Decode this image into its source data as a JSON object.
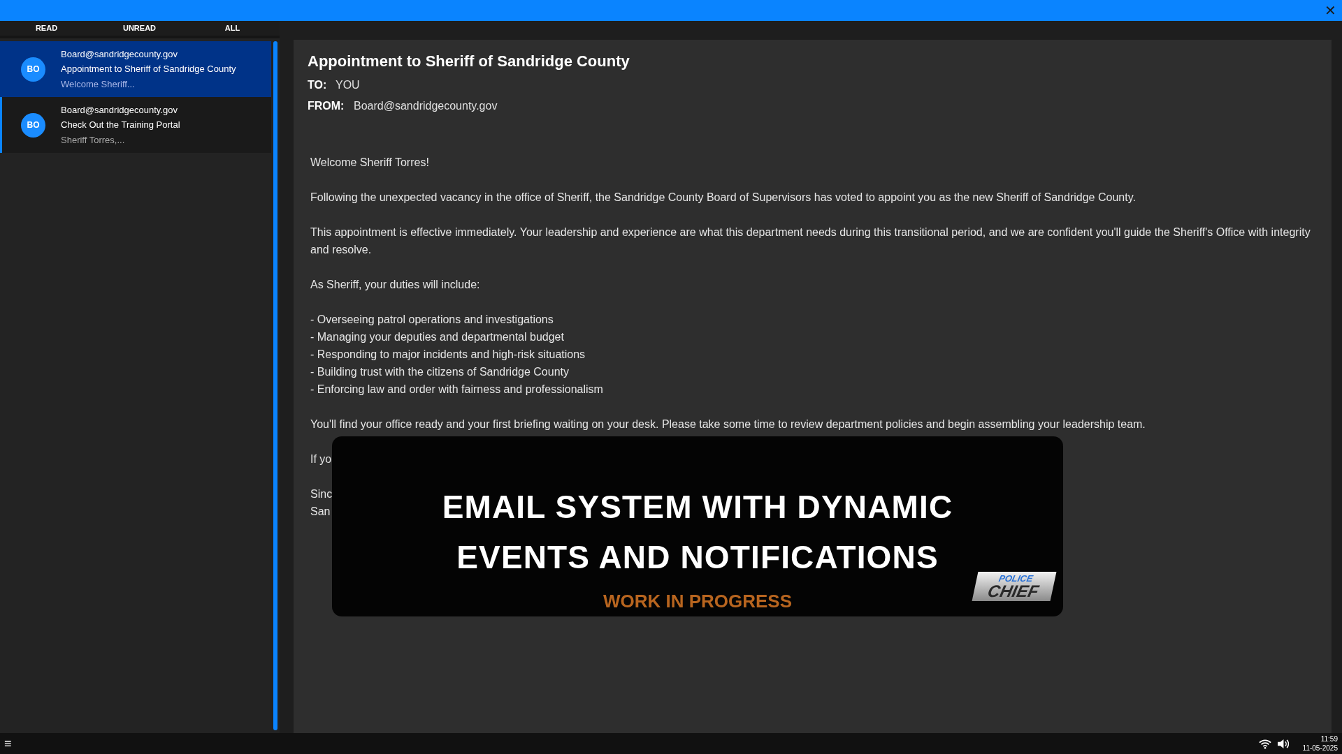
{
  "window": {
    "close": "✕"
  },
  "tabs": [
    {
      "label": "READ"
    },
    {
      "label": "UNREAD"
    },
    {
      "label": "ALL"
    }
  ],
  "emails": [
    {
      "avatar": "BO",
      "from": "Board@sandridgecounty.gov",
      "subject": "Appointment to Sheriff of Sandridge County",
      "preview": "Welcome Sheriff...",
      "selected": true,
      "unread": false
    },
    {
      "avatar": "BO",
      "from": "Board@sandridgecounty.gov",
      "subject": "Check Out the Training Portal",
      "preview": "Sheriff Torres,...",
      "selected": false,
      "unread": true
    }
  ],
  "message": {
    "subject": "Appointment to Sheriff of Sandridge County",
    "to_label": "TO:",
    "to": "YOU",
    "from_label": "FROM:",
    "from": "Board@sandridgecounty.gov",
    "body": [
      "Welcome Sheriff Torres!",
      "Following the unexpected vacancy in the office of Sheriff, the Sandridge County Board of Supervisors has voted to appoint you as the new Sheriff of Sandridge County.",
      "This appointment is effective immediately. Your leadership and experience are what this department needs during this transitional period, and we are confident you'll guide the Sheriff's Office with integrity and resolve.",
      "As Sheriff, your duties will include:",
      [
        "- Overseeing patrol operations and investigations",
        "- Managing your deputies and departmental budget",
        "- Responding to major incidents and high-risk situations",
        "- Building trust with the citizens of Sandridge County",
        "- Enforcing law and order with fairness and professionalism"
      ],
      "You'll find your office ready and your first briefing waiting on your desk. Please take some time to review department policies and begin assembling your leadership team.",
      "If yo",
      [
        "Sinc",
        "San"
      ]
    ]
  },
  "banner": {
    "title_lines": [
      "EMAIL SYSTEM WITH DYNAMIC",
      "EVENTS AND NOTIFICATIONS"
    ],
    "subtitle": "WORK IN PROGRESS",
    "logo_top": "POLICE",
    "logo_bottom": "CHIEF"
  },
  "taskbar": {
    "menu": "≡",
    "time": "11:59",
    "date": "11-05-2025"
  }
}
